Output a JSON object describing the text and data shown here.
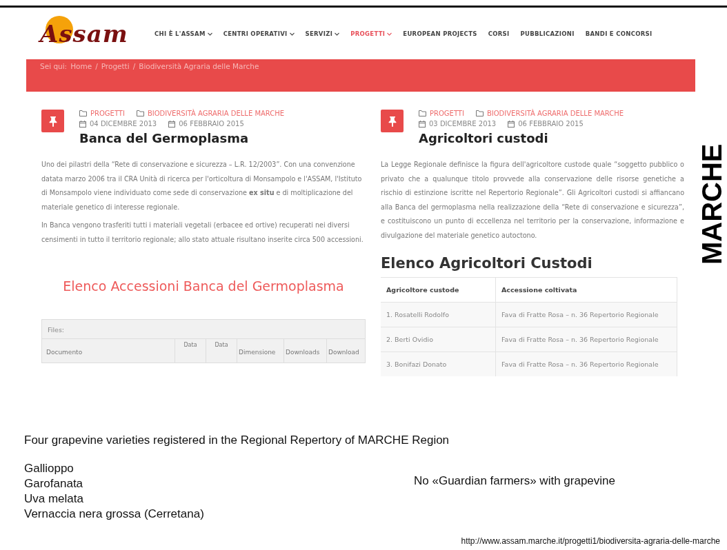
{
  "site": {
    "logo": "Assam",
    "nav": [
      {
        "label": "CHI È L'ASSAM",
        "dropdown": true,
        "selected": false
      },
      {
        "label": "CENTRI OPERATIVI",
        "dropdown": true,
        "selected": false
      },
      {
        "label": "SERVIZI",
        "dropdown": true,
        "selected": false
      },
      {
        "label": "PROGETTI",
        "dropdown": true,
        "selected": true
      },
      {
        "label": "EUROPEAN PROJECTS",
        "dropdown": false,
        "selected": false
      },
      {
        "label": "CORSI",
        "dropdown": false,
        "selected": false
      },
      {
        "label": "PUBBLICAZIONI",
        "dropdown": false,
        "selected": false
      },
      {
        "label": "BANDI E CONCORSI",
        "dropdown": false,
        "selected": false
      }
    ],
    "breadcrumb": {
      "label": "Sei qui:",
      "separator": "/",
      "items": [
        "Home",
        "Progetti",
        "Biodiversità Agraria delle Marche"
      ]
    },
    "articles": [
      {
        "categories": [
          "PROGETTI",
          "BIODIVERSITÀ AGRARIA DELLE MARCHE"
        ],
        "dates": [
          "04 DICEMBRE 2013",
          "06 FEBBRAIO 2015"
        ],
        "title": "Banca del Germoplasma",
        "justified": false,
        "paragraphs": [
          "Uno dei pilastri della “Rete di conservazione e sicurezza – L.R. 12/2003”. Con una convenzione datata marzo 2006 tra il CRA Unità di ricerca per l'orticoltura di Monsampolo e l'ASSAM, l'Istituto di Monsampolo viene individuato come sede di conservazione **ex situ** e di moltiplicazione del materiale genetico di interesse regionale.",
          "In Banca vengono trasferiti tutti i materiali vegetali (erbacee ed ortive) recuperati nei diversi censimenti in tutto il territorio regionale; allo stato attuale risultano inserite circa 500 accessioni."
        ],
        "section": {
          "title": "Elenco Accessioni Banca del Germoplasma",
          "kind": "files",
          "caption": "Files:",
          "columns": [
            "Documento",
            "Data",
            "Data",
            "Dimensione",
            "Downloads",
            "Download"
          ]
        }
      },
      {
        "categories": [
          "PROGETTI",
          "BIODIVERSITÀ AGRARIA DELLE MARCHE"
        ],
        "dates": [
          "03 DICEMBRE 2013",
          "06 FEBBRAIO 2015"
        ],
        "title": "Agricoltori custodi",
        "justified": true,
        "paragraphs": [
          "La Legge Regionale definisce la figura dell'agricoltore custode quale “soggetto pubblico o privato che a qualunque titolo provvede alla conservazione delle risorse genetiche a rischio di estinzione iscritte nel Repertorio Regionale”. Gli Agricoltori custodi si affiancano alla Banca del germoplasma nella realizzazione della “Rete di conservazione e sicurezza”, e costituiscono un punto di eccellenza nel territorio per la conservazione, informazione e divulgazione del materiale genetico autoctono."
        ],
        "section": {
          "title": "Elenco Agricoltori Custodi",
          "kind": "table",
          "columns": [
            "Agricoltore custode",
            "Accessione coltivata"
          ],
          "rows": [
            [
              "1. Rosatelli Rodolfo",
              "Fava di Fratte Rosa – n. 36 Repertorio Regionale"
            ],
            [
              "2. Berti Ovidio",
              "Fava di Fratte Rosa – n. 36 Repertorio Regionale"
            ],
            [
              "3. Bonifazi Donato",
              "Fava di Fratte Rosa – n. 36 Repertorio Regionale"
            ]
          ]
        }
      }
    ]
  },
  "side_label": "MARCHE",
  "slide": {
    "caption": "Four grapevine varieties registered in the Regional Repertory of  MARCHE Region",
    "varieties": [
      "Gallioppo",
      "Garofanata",
      "Uva melata",
      "Vernaccia nera grossa (Cerretana)"
    ],
    "note": "No «Guardian farmers» with grapevine",
    "source": "http://www.assam.marche.it/progetti1/biodiversita-agraria-delle-marche"
  }
}
